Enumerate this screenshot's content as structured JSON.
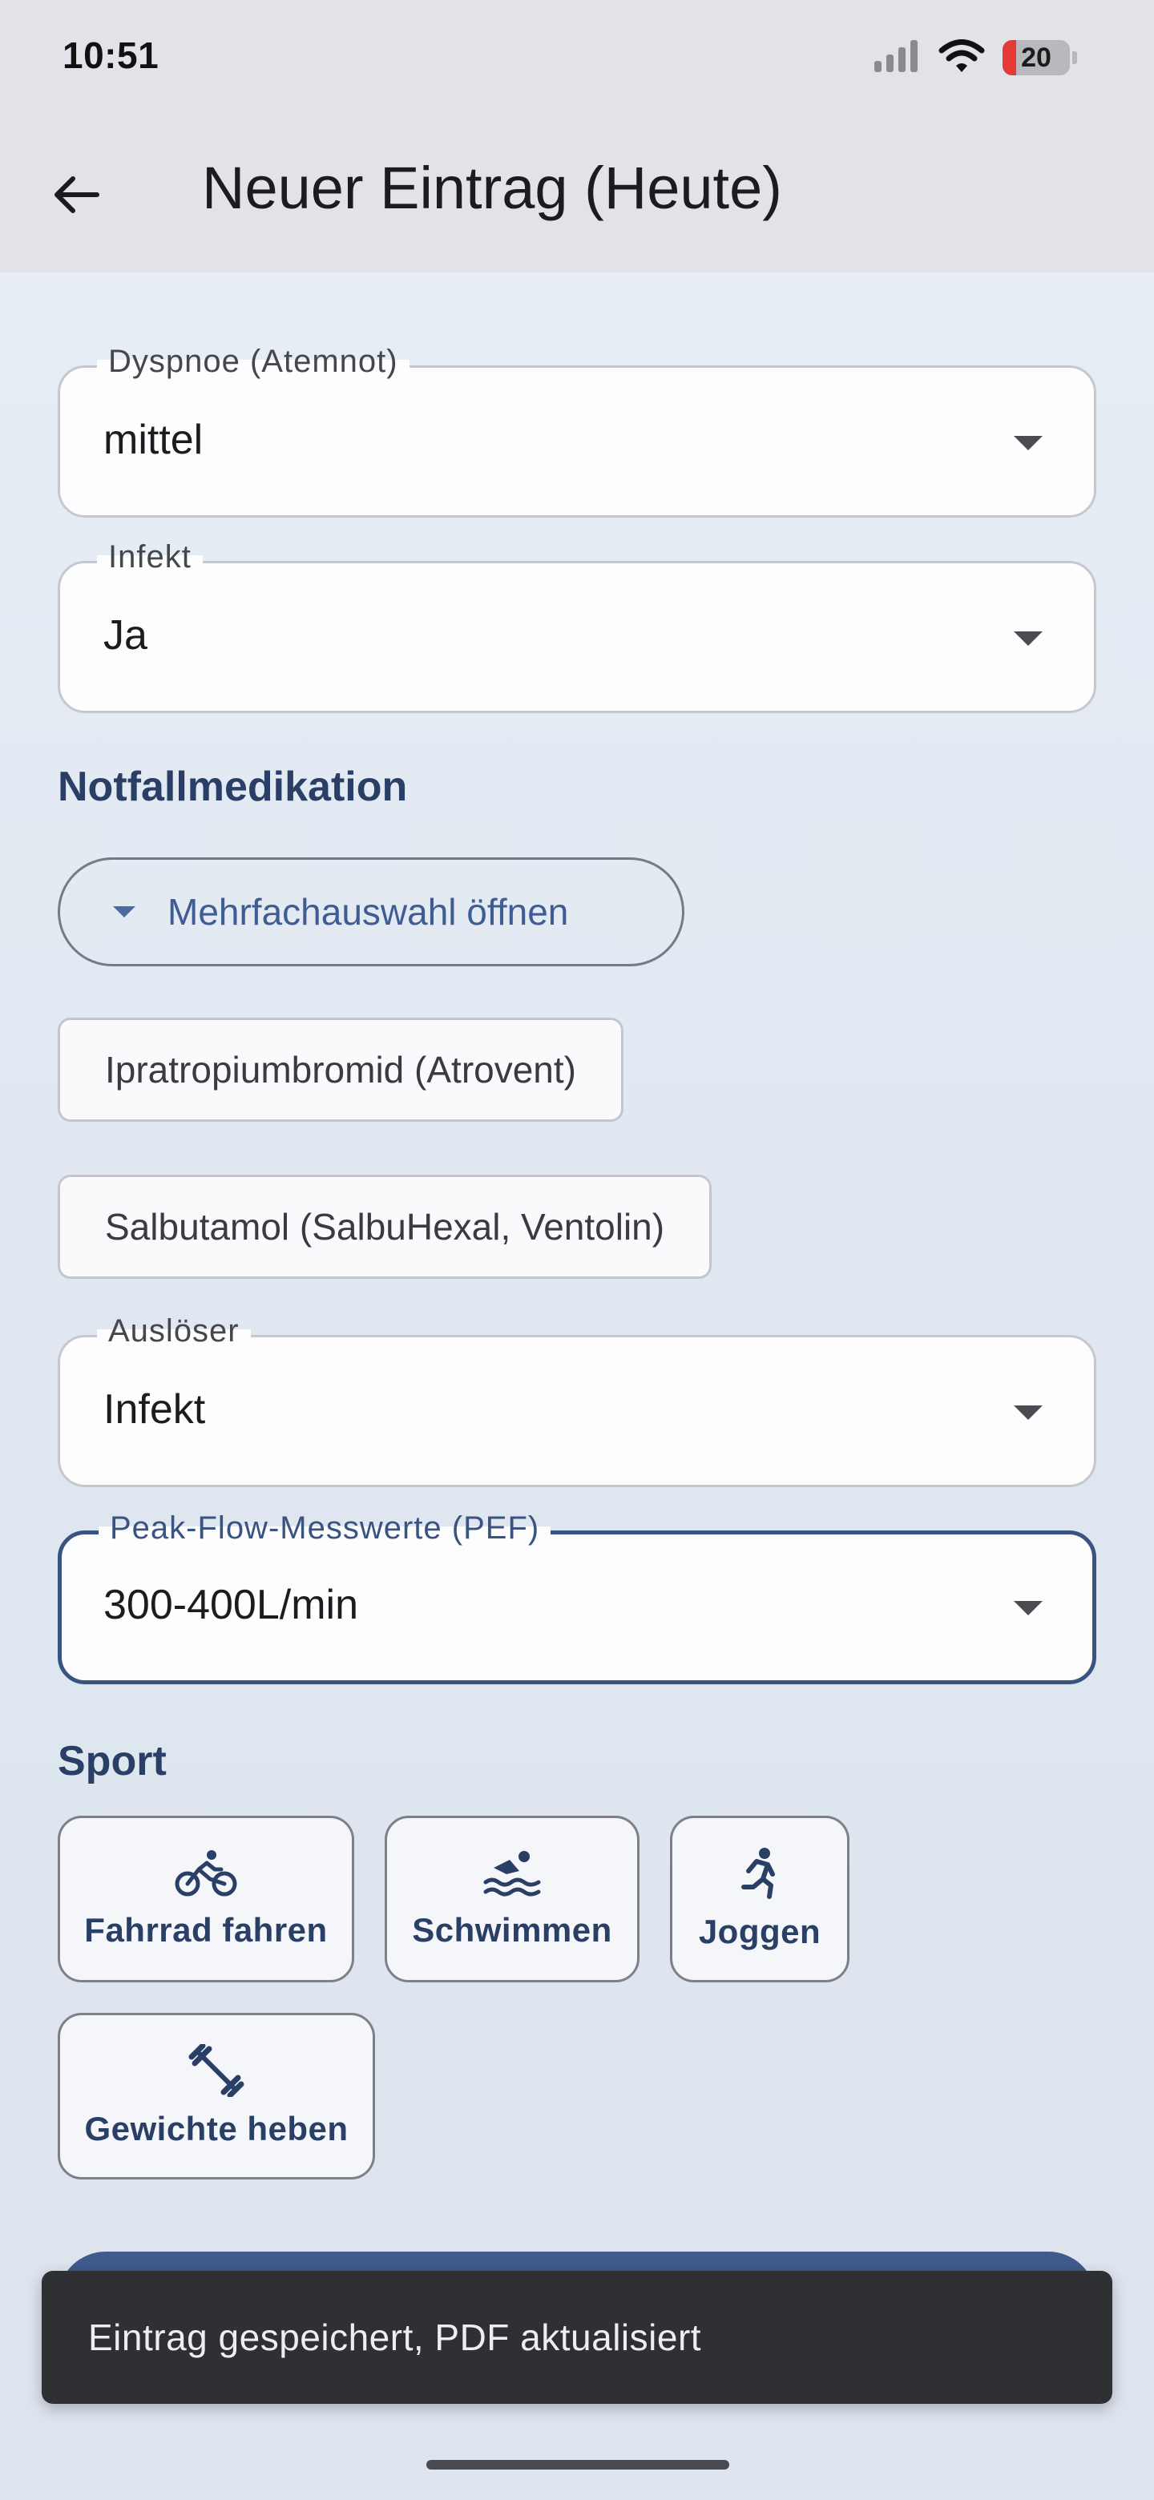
{
  "status_bar": {
    "time": "10:51",
    "battery_level": "20",
    "battery_color": "#e53935"
  },
  "app_bar": {
    "back_icon": "arrow-back-icon",
    "title": "Neuer Eintrag (Heute)"
  },
  "fields": {
    "dyspnoe": {
      "label": "Dyspnoe (Atemnot)",
      "value": "mittel"
    },
    "infekt": {
      "label": "Infekt",
      "value": "Ja"
    },
    "ausloeser": {
      "label": "Auslöser",
      "value": "Infekt"
    },
    "peak_flow": {
      "label": "Peak-Flow-Messwerte (PEF)",
      "value": "300-400L/min"
    }
  },
  "notfallmedikation": {
    "title": "Notfallmedikation",
    "multi_select_label": "Mehrfachauswahl öffnen",
    "selected": [
      "Ipratropiumbromid (Atrovent)",
      "Salbutamol (SalbuHexal, Ventolin)"
    ]
  },
  "sport": {
    "title": "Sport",
    "options": [
      {
        "label": "Fahrrad fahren",
        "icon": "bike-icon"
      },
      {
        "label": "Schwimmen",
        "icon": "swim-icon"
      },
      {
        "label": "Joggen",
        "icon": "run-icon"
      },
      {
        "label": "Gewichte heben",
        "icon": "dumbbell-icon"
      }
    ]
  },
  "snackbar": {
    "message": "Eintrag gespeichert, PDF aktualisiert"
  },
  "colors": {
    "accent": "#3a5482",
    "section_title": "#2a3f66",
    "snackbar_bg": "#2f3034"
  }
}
